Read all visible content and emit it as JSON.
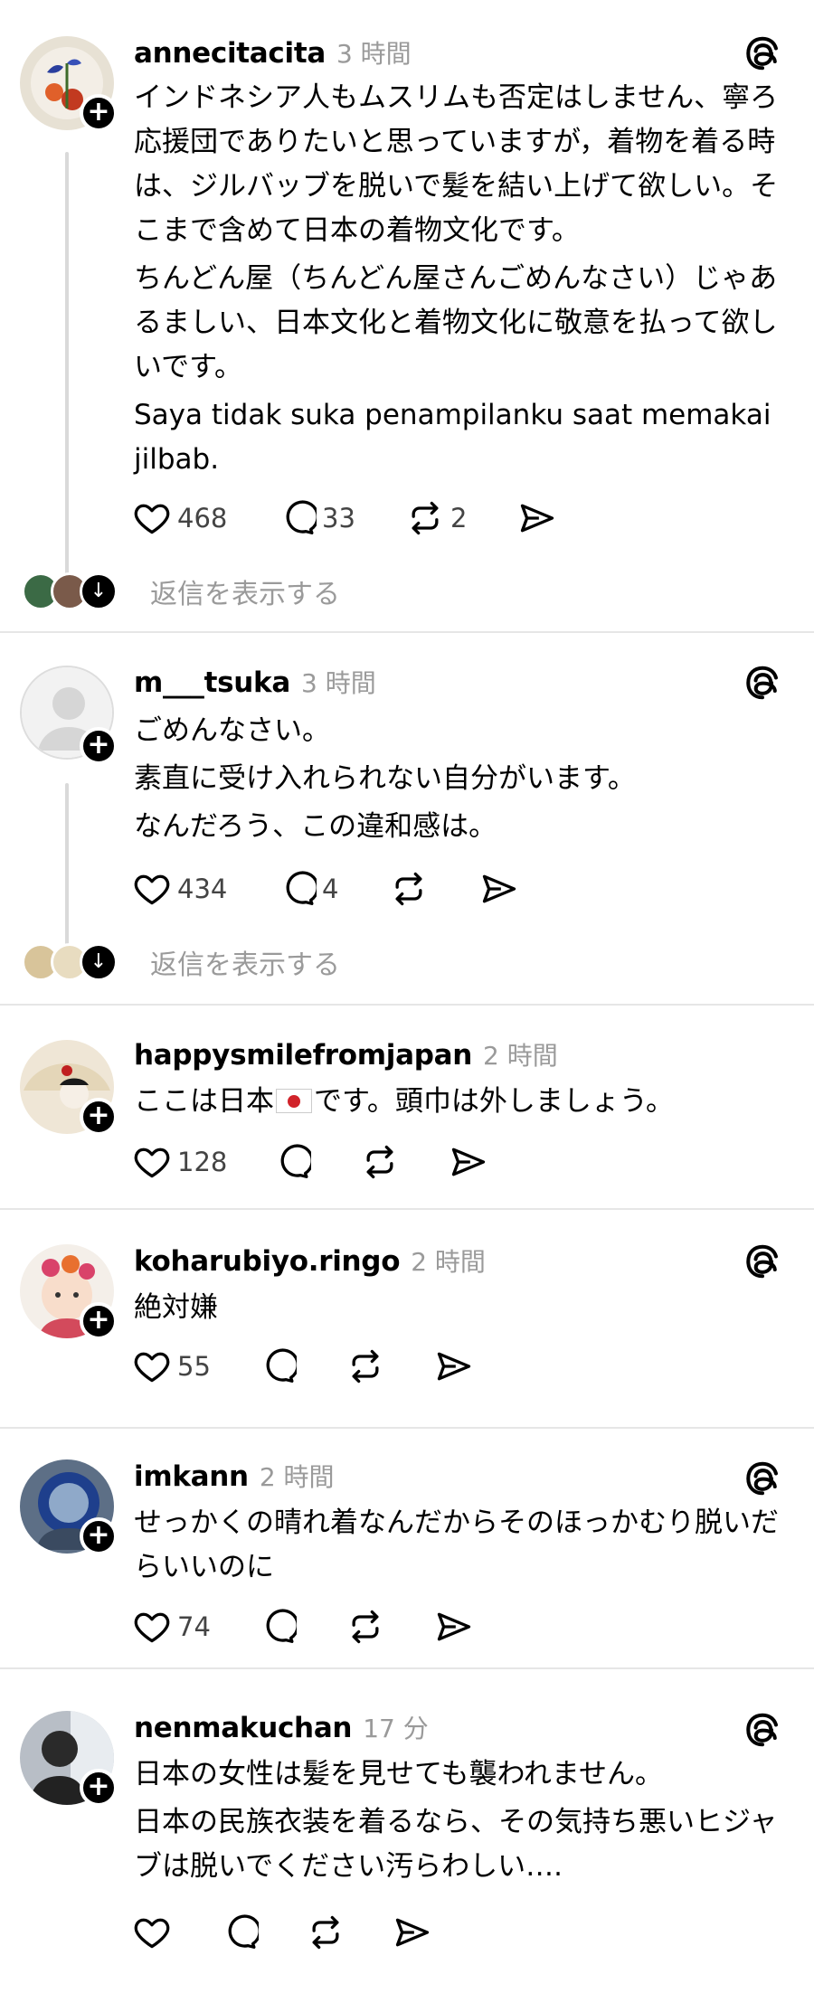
{
  "labels": {
    "view_replies": "返信を表示する",
    "follow": "+"
  },
  "posts": [
    {
      "username": "annecitacita",
      "time": "3 時間",
      "paragraphs": [
        "インドネシア人もムスリムも否定はしません、寧ろ応援団でありたいと思っていますが，着物を着る時は、ジルバッブを脱いで髪を結い上げて欲しい。そこまで含めて日本の着物文化です。",
        "ちんどん屋（ちんどん屋さんごめんなさい）じゃあるましい、日本文化と着物文化に敬意を払って欲しいです。",
        "Saya tidak suka penampilanku saat memakai jilbab."
      ],
      "likes": "468",
      "comments": "33",
      "reposts": "2"
    },
    {
      "username": "m___tsuka",
      "time": "3 時間",
      "paragraphs": [
        "ごめんなさい。",
        "素直に受け入れられない自分がいます。",
        "なんだろう、この違和感は。"
      ],
      "likes": "434",
      "comments": "4",
      "reposts": ""
    },
    {
      "username": "happysmilefromjapan",
      "time": "2 時間",
      "text_before_flag": "ここは日本",
      "text_after_flag": "です。頭巾は外しましょう。",
      "likes": "128",
      "comments": "",
      "reposts": ""
    },
    {
      "username": "koharubiyo.ringo",
      "time": "2 時間",
      "paragraphs": [
        "絶対嫌"
      ],
      "likes": "55",
      "comments": "",
      "reposts": ""
    },
    {
      "username": "imkann",
      "time": "2 時間",
      "paragraphs": [
        "せっかくの晴れ着なんだからそのほっかむり脱いだらいいのに"
      ],
      "likes": "74",
      "comments": "",
      "reposts": ""
    },
    {
      "username": "nenmakuchan",
      "time": "17 分",
      "paragraphs": [
        "日本の女性は髪を見せても襲われません。",
        "日本の民族衣装を着るなら、その気持ち悪いヒジャブは脱いでください汚らわしい…."
      ],
      "likes": "",
      "comments": "",
      "reposts": ""
    }
  ]
}
